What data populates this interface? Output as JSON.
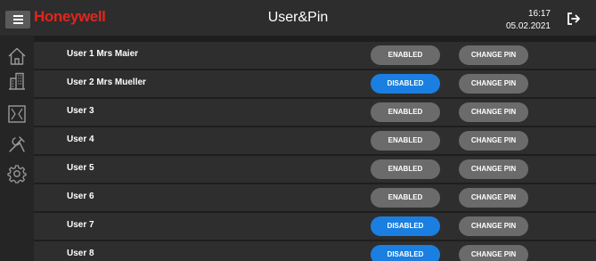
{
  "header": {
    "brand": "Honeywell",
    "title": "User&Pin",
    "time": "16:17",
    "date": "05.02.2021"
  },
  "icons": {
    "menu": "hamburger-menu-icon",
    "logout": "logout-icon",
    "sidebar": [
      "home-icon",
      "building-icon",
      "window-blinds-icon",
      "tools-icon",
      "settings-gear-icon"
    ]
  },
  "colors": {
    "brand": "#e1261c",
    "enabled_button": "#6b6b6b",
    "disabled_button": "#1a7fe0"
  },
  "users": [
    {
      "name": "User 1 Mrs Maier",
      "state": "ENABLED",
      "pin_label": "CHANGE PIN"
    },
    {
      "name": "User 2 Mrs Mueller",
      "state": "DISABLED",
      "pin_label": "CHANGE PIN"
    },
    {
      "name": "User 3",
      "state": "ENABLED",
      "pin_label": "CHANGE PIN"
    },
    {
      "name": "User 4",
      "state": "ENABLED",
      "pin_label": "CHANGE PIN"
    },
    {
      "name": "User 5",
      "state": "ENABLED",
      "pin_label": "CHANGE PIN"
    },
    {
      "name": "User 6",
      "state": "ENABLED",
      "pin_label": "CHANGE PIN"
    },
    {
      "name": "User 7",
      "state": "DISABLED",
      "pin_label": "CHANGE PIN"
    },
    {
      "name": "User 8",
      "state": "DISABLED",
      "pin_label": "CHANGE PIN"
    }
  ]
}
